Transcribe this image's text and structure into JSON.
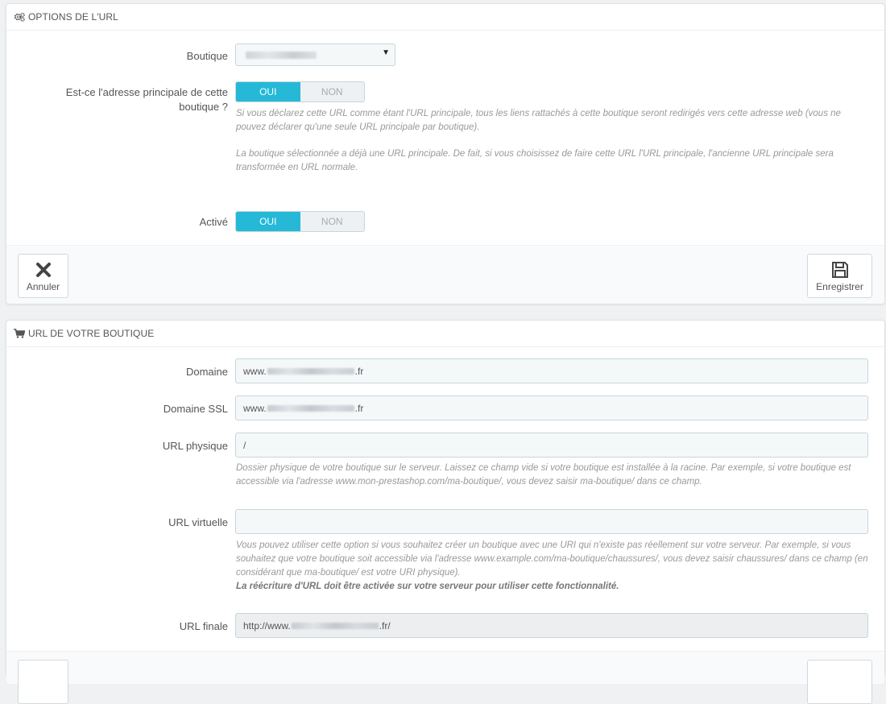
{
  "url_options": {
    "title": "OPTIONS DE L'URL",
    "shop_label": "Boutique",
    "main_label_line1": "Est-ce l'adresse principale de cette",
    "main_label_line2": "boutique ?",
    "main_yes": "OUI",
    "main_no": "NON",
    "main_help_1": "Si vous déclarez cette URL comme étant l'URL principale, tous les liens rattachés à cette boutique seront redirigés vers cette adresse web (vous ne pouvez déclarer qu'une seule URL principale par boutique).",
    "main_help_2": "La boutique sélectionnée a déjà une URL principale. De fait, si vous choisissez de faire cette URL l'URL principale, l'ancienne URL principale sera transformée en URL normale.",
    "active_label": "Activé",
    "active_yes": "OUI",
    "active_no": "NON",
    "cancel_label": "Annuler",
    "save_label": "Enregistrer"
  },
  "shop_url": {
    "title": "URL DE VOTRE BOUTIQUE",
    "domain_label": "Domaine",
    "domain_prefix": "www.",
    "domain_suffix": ".fr",
    "domain_ssl_label": "Domaine SSL",
    "domain_ssl_prefix": "www.",
    "domain_ssl_suffix": ".fr",
    "physical_label": "URL physique",
    "physical_value": "/",
    "physical_help": "Dossier physique de votre boutique sur le serveur. Laissez ce champ vide si votre boutique est installée à la racine. Par exemple, si votre boutique est accessible via l'adresse www.mon-prestashop.com/ma-boutique/, vous devez saisir ma-boutique/ dans ce champ.",
    "virtual_label": "URL virtuelle",
    "virtual_value": "",
    "virtual_help": "Vous pouvez utiliser cette option si vous souhaitez créer un boutique avec une URI qui n'existe pas réellement sur votre serveur. Par exemple, si vous souhaitez que votre boutique soit accessible via l'adresse www.example.com/ma-boutique/chaussures/, vous devez saisir chaussures/ dans ce champ (en considérant que ma-boutique/ est votre URI physique).",
    "virtual_help_bold": "La réécriture d'URL doit être activée sur votre serveur pour utiliser cette fonctionnalité.",
    "final_label": "URL finale",
    "final_prefix": "http://www.",
    "final_suffix": ".fr/"
  },
  "colors": {
    "accent": "#25b9d7",
    "background": "#eff1f2"
  },
  "icons": {
    "options_heading": "cogs-icon",
    "shop_heading": "shopping-cart-icon",
    "cancel": "close-icon",
    "save": "floppy-disk-icon"
  }
}
